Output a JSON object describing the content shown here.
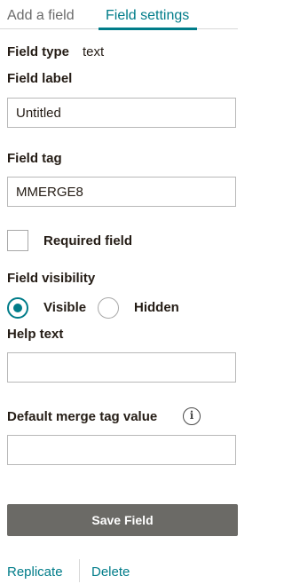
{
  "tabs": {
    "add_field": "Add a field",
    "field_settings": "Field settings"
  },
  "field_type": {
    "label": "Field type",
    "value": "text"
  },
  "field_label": {
    "label": "Field label",
    "value": "Untitled"
  },
  "field_tag": {
    "label": "Field tag",
    "value": "MMERGE8"
  },
  "required": {
    "label": "Required field",
    "checked": false
  },
  "visibility": {
    "label": "Field visibility",
    "options": [
      {
        "label": "Visible",
        "selected": true
      },
      {
        "label": "Hidden",
        "selected": false
      }
    ]
  },
  "help_text": {
    "label": "Help text",
    "value": ""
  },
  "default_merge": {
    "label": "Default merge tag value",
    "value": "",
    "info_icon": "info-icon"
  },
  "actions": {
    "save_label": "Save Field",
    "replicate_label": "Replicate",
    "delete_label": "Delete"
  },
  "colors": {
    "accent": "#007c89",
    "button": "#6b6a66",
    "text": "#241c15"
  }
}
